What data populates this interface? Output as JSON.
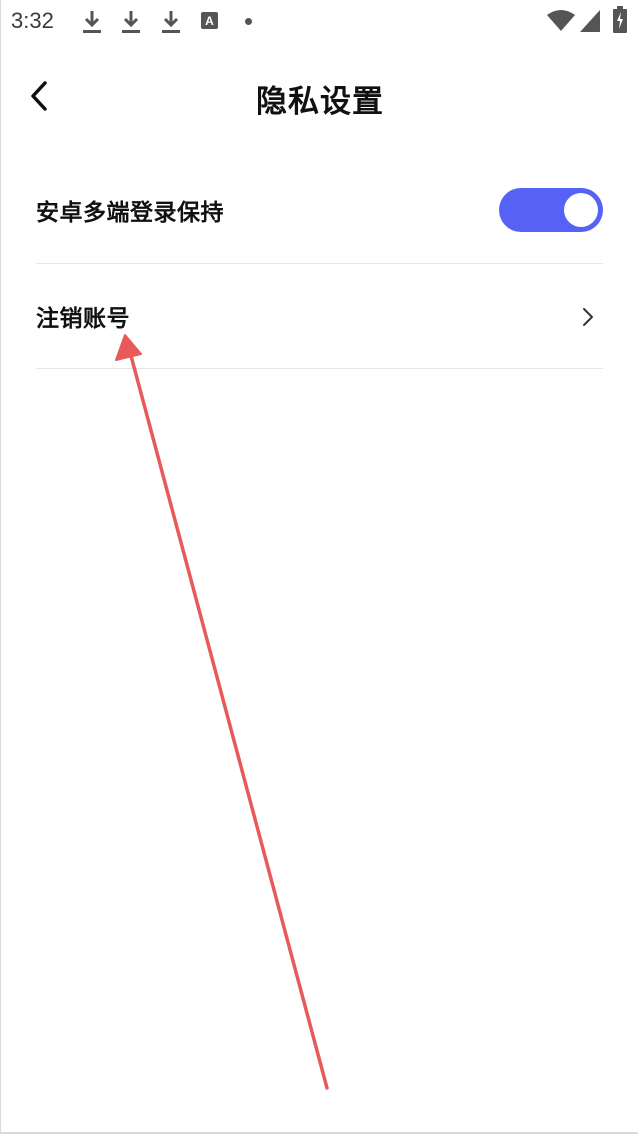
{
  "status_bar": {
    "time": "3:32",
    "icons": [
      "download-icon",
      "download-icon",
      "download-icon",
      "a-notification-icon",
      "dot-icon",
      "wifi-icon",
      "signal-icon",
      "battery-charging-icon"
    ],
    "a_label": "A"
  },
  "nav": {
    "title": "隐私设置",
    "back_icon": "chevron-left-icon"
  },
  "settings": {
    "items": [
      {
        "label": "安卓多端登录保持",
        "type": "toggle",
        "value": true
      },
      {
        "label": "注销账号",
        "type": "link",
        "icon": "chevron-right-icon"
      }
    ]
  },
  "colors": {
    "accent": "#5562f5",
    "annotation": "#e85a5a"
  }
}
